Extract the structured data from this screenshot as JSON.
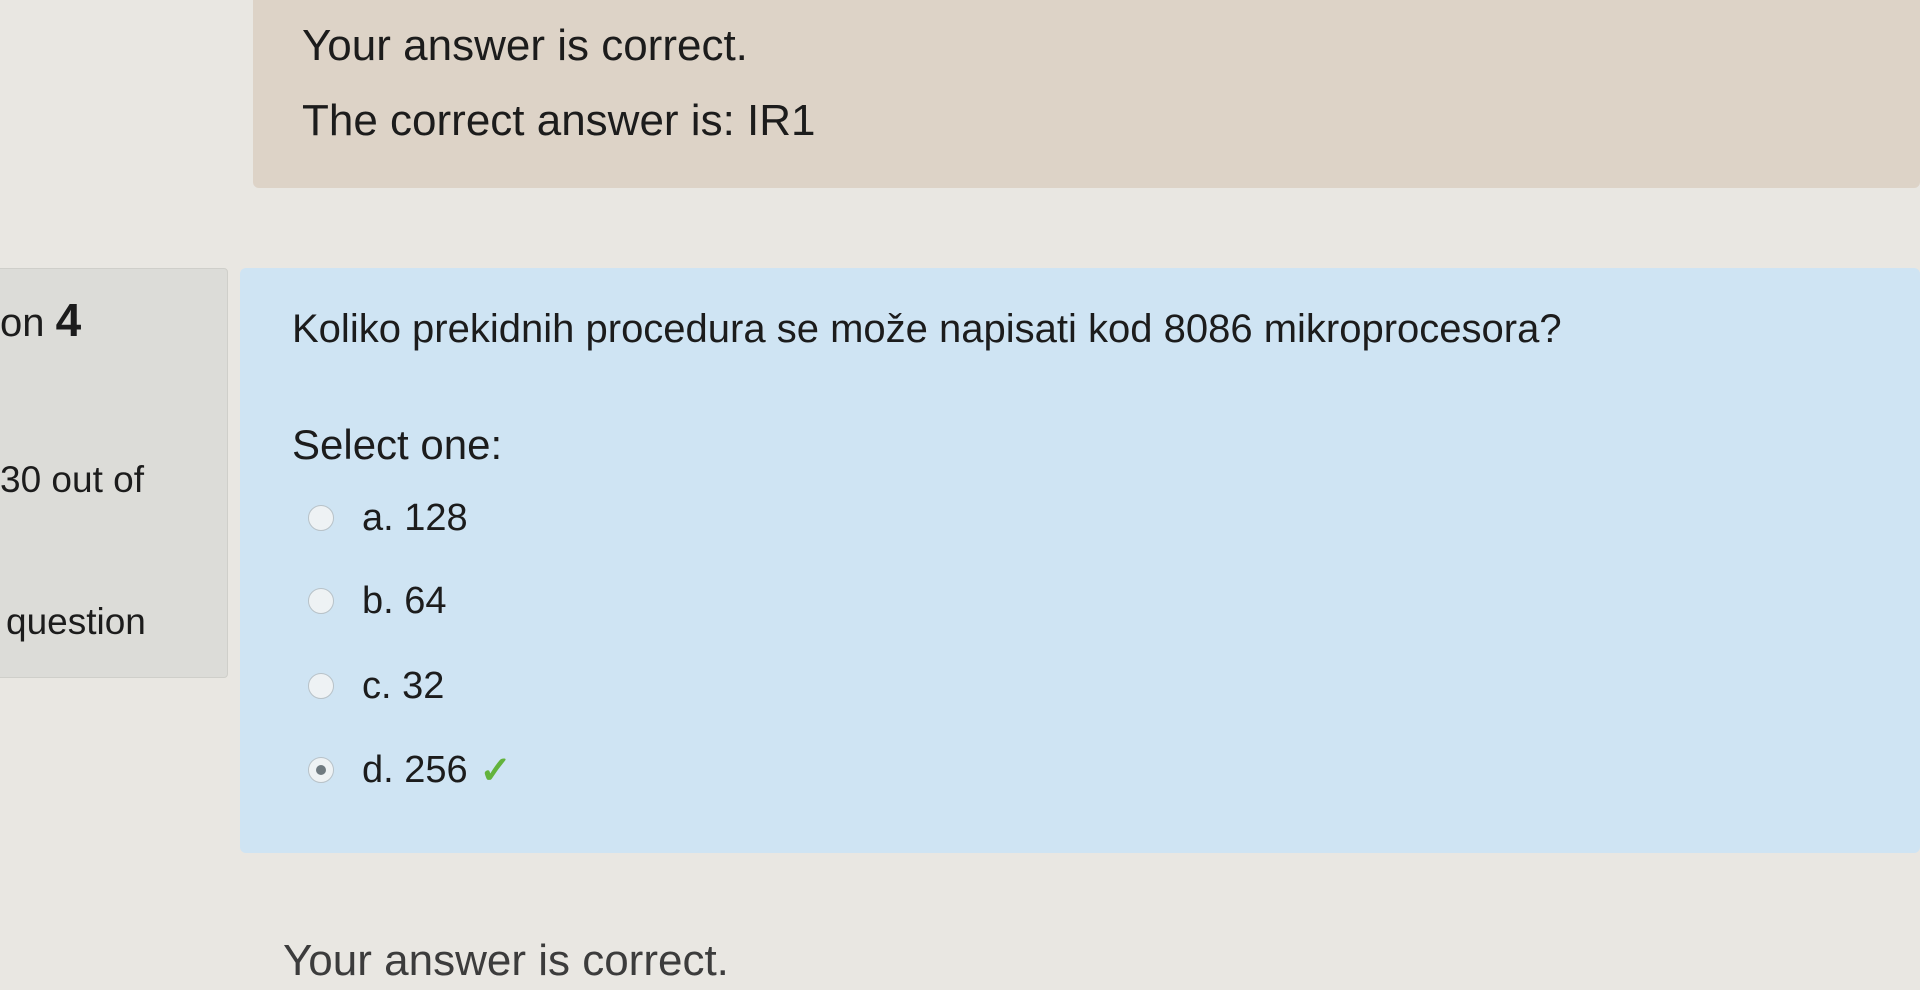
{
  "feedback_top": {
    "line1": "Your answer is correct.",
    "line2": "The correct answer is: IR1"
  },
  "info": {
    "question_prefix": "on",
    "question_number": "4",
    "mark": "30 out of",
    "flag": "question"
  },
  "question": {
    "text": "Koliko prekidnih procedura se može napisati kod 8086 mikroprocesora?",
    "prompt": "Select one:",
    "options": [
      {
        "label": "a. 128",
        "selected": false
      },
      {
        "label": "b. 64",
        "selected": false
      },
      {
        "label": "c. 32",
        "selected": false
      },
      {
        "label": "d. 256",
        "selected": true
      }
    ],
    "correct_mark": "✓"
  },
  "feedback_bottom": {
    "line1": "Your answer is correct."
  },
  "colors": {
    "question_bg": "#cfe4f3",
    "feedback_bg": "#ddd3c7",
    "check": "#63b33c"
  }
}
